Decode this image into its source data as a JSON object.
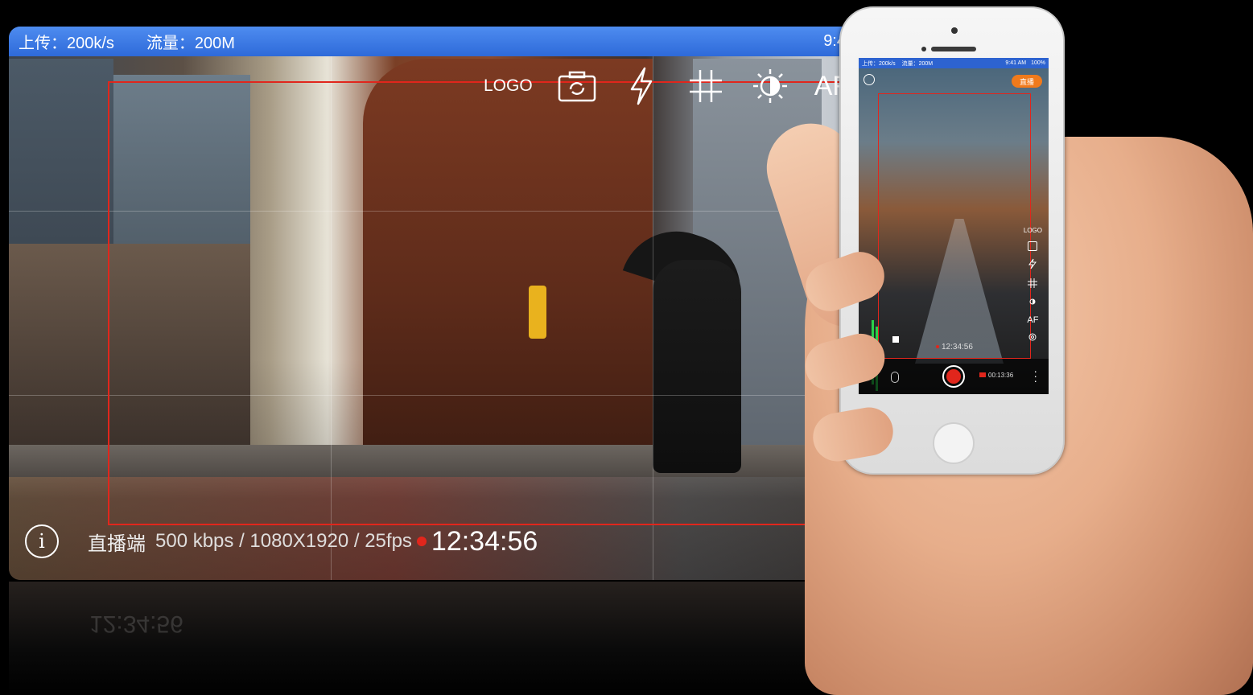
{
  "landscape_view": {
    "status_bar": {
      "upload": "上传：200k/s",
      "traffic": "流量：200M",
      "clock": "9:4"
    },
    "toolbar": {
      "logo_label": "LOGO",
      "icons": [
        "camera-switch-icon",
        "flash-icon",
        "grid-icon",
        "brightness-icon"
      ],
      "af_label": "AF"
    },
    "info_bar": {
      "info_icon_glyph": "i",
      "role_label": "直播端",
      "stream_spec": "500 kbps / 1080X1920 / 25fps",
      "rec_time": "12:34:56"
    },
    "accent_colors": {
      "status_bar": "#2e6ad9",
      "frame": "#e1261c",
      "record": "#e1261c"
    }
  },
  "phone_view": {
    "status_bar": {
      "upload": "上传：200k/s",
      "traffic": "流量：200M",
      "time": "9:41 AM",
      "battery": "100%"
    },
    "live_badge": "直播",
    "side_tools": {
      "logo_label": "LOGO",
      "icons": [
        "camera-switch-icon",
        "flash-icon",
        "grid-icon",
        "brightness-icon"
      ],
      "af_label": "AF",
      "settings_icon": "gear-icon"
    },
    "timestamp": "12:34:56",
    "bottom_bar": {
      "mic_icon": "microphone-icon",
      "record_button": "record-button",
      "record_elapsed": "00:13:36",
      "more_icon": "more-vertical-icon"
    },
    "accent_colors": {
      "live_badge": "#f07a1c",
      "audio_meter": "#2ad14a"
    }
  }
}
